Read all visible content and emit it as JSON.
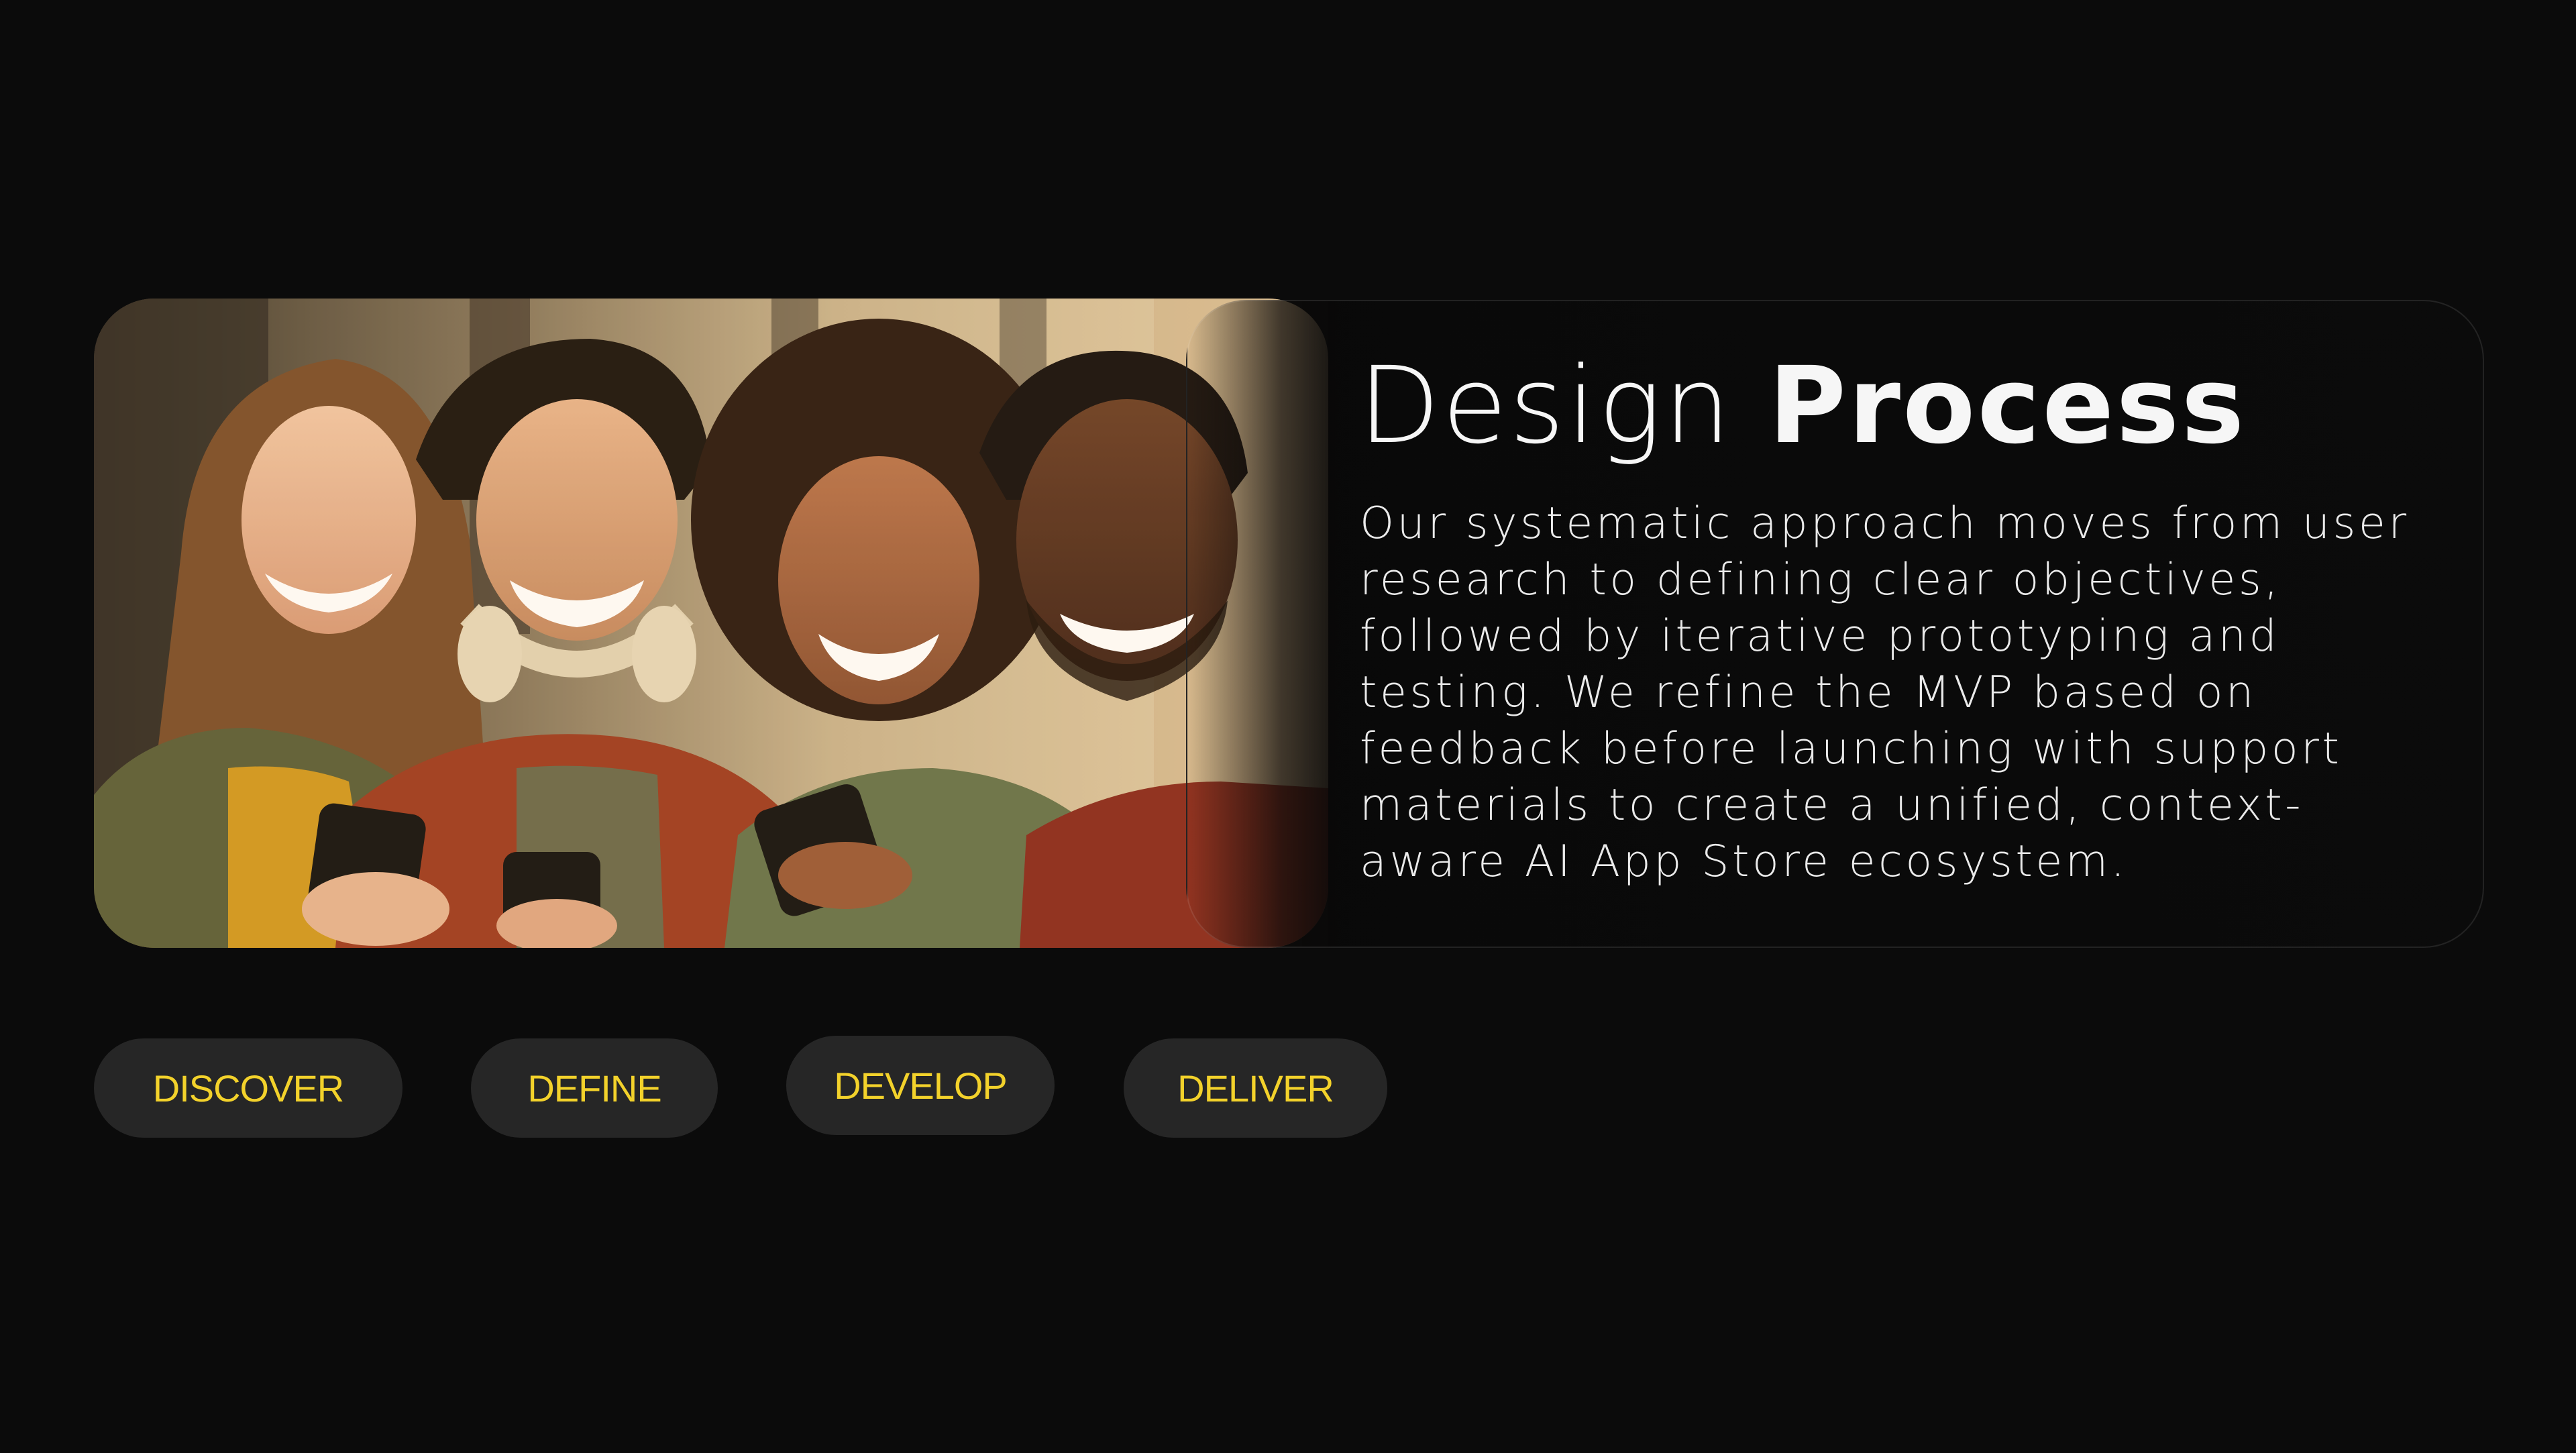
{
  "title": {
    "light": "Design ",
    "bold": "Process"
  },
  "description": "Our systematic approach moves from user research to defining clear objectives, followed by iterative prototyping and testing. We refine the MVP based on feedback before launching with support materials to create a unified, context-aware AI App Store ecosystem.",
  "hero_image": {
    "alt": "Four friends laughing while looking at their smartphones"
  },
  "phases": [
    {
      "label": "DISCOVER"
    },
    {
      "label": "DEFINE"
    },
    {
      "label": "DEVELOP"
    },
    {
      "label": "DELIVER"
    }
  ],
  "colors": {
    "background": "#0b0b0b",
    "pill_background": "#262626",
    "pill_text": "#f3d22b",
    "title_text": "#f6f6f6"
  }
}
